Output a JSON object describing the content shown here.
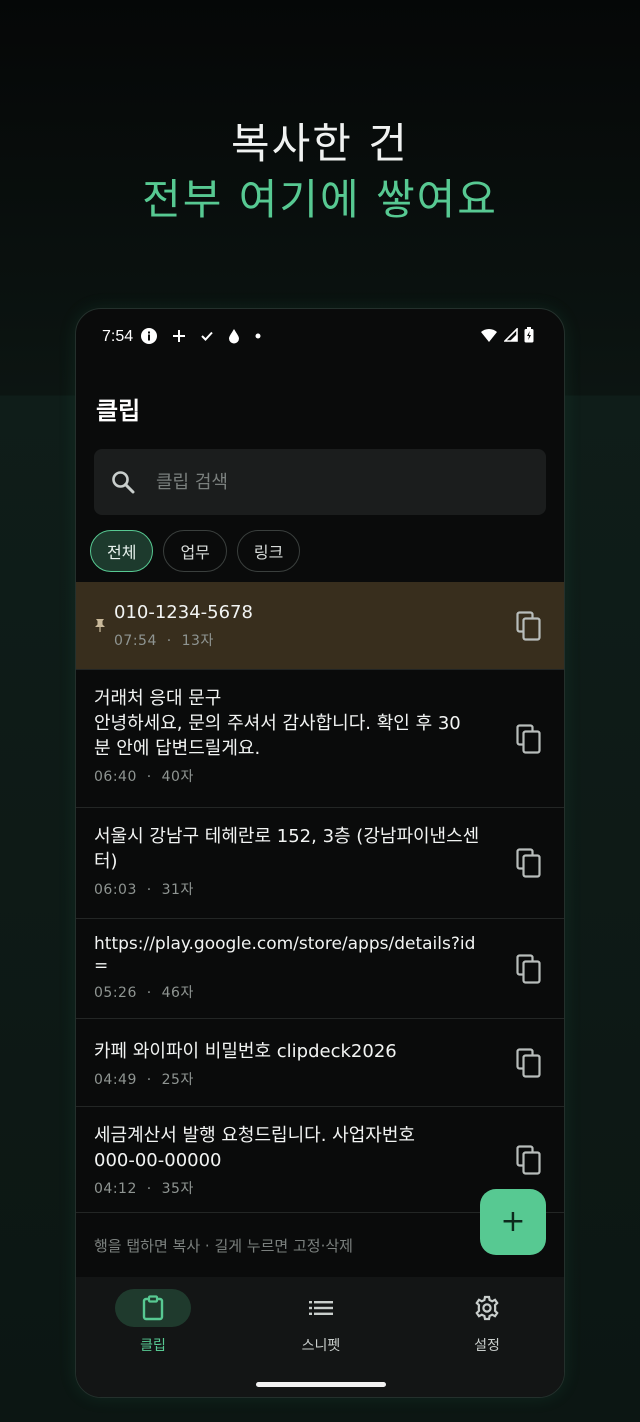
{
  "headline": {
    "line1": "복사한 건",
    "line2": "전부 여기에 쌓여요"
  },
  "status": {
    "time": "7:54"
  },
  "app": {
    "title": "클립"
  },
  "search": {
    "placeholder": "클립 검색",
    "value": ""
  },
  "chips": [
    {
      "label": "전체",
      "active": true
    },
    {
      "label": "업무",
      "active": false
    },
    {
      "label": "링크",
      "active": false
    }
  ],
  "clips": [
    {
      "text": "010-1234-5678",
      "time": "07:54",
      "sep": "·",
      "count": "13자",
      "pinned": true
    },
    {
      "text": "거래처 응대 문구\n안녕하세요, 문의 주셔서 감사합니다. 확인 후 30\n분 안에 답변드릴게요.",
      "time": "06:40",
      "sep": "·",
      "count": "40자",
      "pinned": false
    },
    {
      "text": "서울시 강남구 테헤란로 152, 3층 (강남파이낸스센\n터)",
      "time": "06:03",
      "sep": "·",
      "count": "31자",
      "pinned": false
    },
    {
      "text": "https://play.google.com/store/apps/details?id\n=",
      "time": "05:26",
      "sep": "·",
      "count": "46자",
      "pinned": false
    },
    {
      "text": "카페 와이파이 비밀번호 clipdeck2026",
      "time": "04:49",
      "sep": "·",
      "count": "25자",
      "pinned": false
    },
    {
      "text": "세금계산서 발행 요청드립니다. 사업자번호\n000-00-00000",
      "time": "04:12",
      "sep": "·",
      "count": "35자",
      "pinned": false
    }
  ],
  "hint": "행을 탭하면 복사 · 길게 누르면 고정·삭제",
  "fab": {
    "label": "+"
  },
  "nav": [
    {
      "label": "클립",
      "icon": "clipboard-icon",
      "active": true
    },
    {
      "label": "스니펫",
      "icon": "list-icon",
      "active": false
    },
    {
      "label": "설정",
      "icon": "gear-icon",
      "active": false
    }
  ],
  "colors": {
    "accent": "#57c992",
    "pinned_bg": "#382e1d",
    "background": "#0a0b0b"
  }
}
